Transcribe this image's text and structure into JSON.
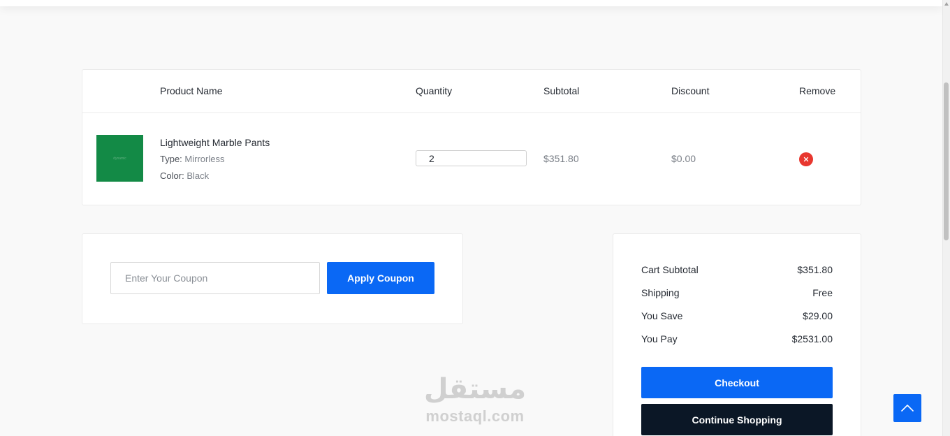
{
  "table": {
    "headers": {
      "product_name": "Product Name",
      "quantity": "Quantity",
      "subtotal": "Subtotal",
      "discount": "Discount",
      "remove": "Remove"
    },
    "item": {
      "name": "Lightweight Marble Pants",
      "type_label": "Type:",
      "type_value": "Mirrorless",
      "color_label": "Color:",
      "color_value": "Black",
      "quantity": "2",
      "subtotal": "$351.80",
      "discount": "$0.00",
      "image_text": "dynamic",
      "image_color": "#138a46"
    }
  },
  "coupon": {
    "placeholder": "Enter Your Coupon",
    "apply_label": "Apply Coupon"
  },
  "summary": {
    "rows": [
      {
        "label": "Cart Subtotal",
        "value": "$351.80"
      },
      {
        "label": "Shipping",
        "value": "Free"
      },
      {
        "label": "You Save",
        "value": "$29.00"
      },
      {
        "label": "You Pay",
        "value": "$2531.00"
      }
    ],
    "checkout_label": "Checkout",
    "continue_label": "Continue Shopping"
  },
  "watermark": {
    "arabic": "مستقل",
    "latin": "mostaql.com"
  },
  "icons": {
    "remove": "close-circle-icon",
    "back_to_top": "chevron-up-icon"
  },
  "colors": {
    "primary": "#0a68f5",
    "dark": "#0b1726",
    "danger": "#e8372f"
  }
}
